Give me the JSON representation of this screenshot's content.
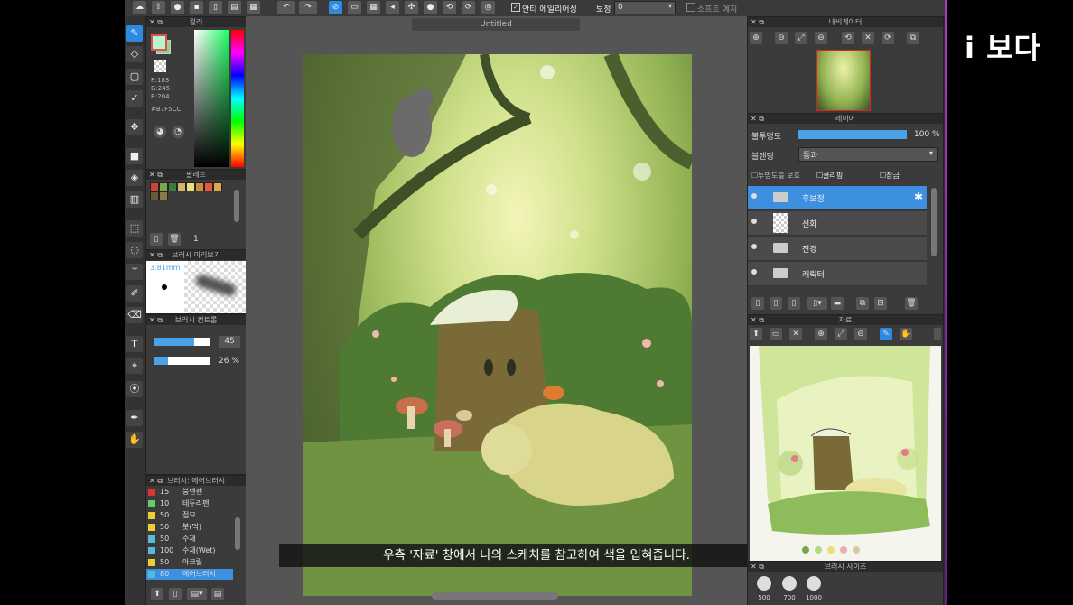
{
  "logo": "i 보다",
  "toolbar": {
    "title": "Untitled",
    "antialias_label": "안티 에일리어싱",
    "correction_label": "보정",
    "correction_value": "0",
    "soft_edge_label": "소프트 에지"
  },
  "color_panel": {
    "title": "컬러",
    "r": "R:183",
    "g": "G:245",
    "b": "B:204",
    "hex": "#B7F5CC",
    "fg_color": "#B7F5CC",
    "bg_color": "#8bd68a"
  },
  "palette_panel": {
    "title": "팔레트",
    "count": "1",
    "swatches": [
      "#c9453a",
      "#7aa64e",
      "#3f7a3d",
      "#d6b36a",
      "#e8e07a",
      "#c98c3a",
      "#e6563c",
      "#d9a84b",
      "#6b5a3a",
      "#8a7a4a"
    ]
  },
  "brush_preview": {
    "title": "브러시 미리보기",
    "size": "3.81mm"
  },
  "brush_control": {
    "title": "브러시 컨트롤",
    "size_value": "45",
    "opacity_value": "26 %",
    "size_fraction": 0.72,
    "opacity_fraction": 0.26
  },
  "brush_list": {
    "title": "브러시: 에어브러시",
    "items": [
      {
        "size": "15",
        "name": "붕텐펜",
        "color": "#d33"
      },
      {
        "size": "10",
        "name": "테두리펜",
        "color": "#6c6"
      },
      {
        "size": "50",
        "name": "점묘",
        "color": "#ec3"
      },
      {
        "size": "50",
        "name": "붓(먹)",
        "color": "#ec3"
      },
      {
        "size": "50",
        "name": "수채",
        "color": "#5bd"
      },
      {
        "size": "100",
        "name": "수채(Wet)",
        "color": "#5bd"
      },
      {
        "size": "50",
        "name": "아크릴",
        "color": "#ec3"
      },
      {
        "size": "80",
        "name": "에어브러시",
        "color": "#5bd"
      }
    ]
  },
  "navigator": {
    "title": "내비게이터"
  },
  "layer_panel": {
    "title": "레이어",
    "opacity_label": "불투명도",
    "opacity_value": "100 %",
    "opacity_fraction": 1.0,
    "blend_label": "블렌딩",
    "blend_value": "통과",
    "protect_alpha": "투명도를 보호",
    "clipping": "클리핑",
    "reference": "참금",
    "layers": [
      {
        "name": "후보정",
        "type": "folder",
        "selected": true
      },
      {
        "name": "선화",
        "type": "layer",
        "selected": false
      },
      {
        "name": "전경",
        "type": "folder",
        "selected": false
      },
      {
        "name": "캐릭터",
        "type": "folder",
        "selected": false
      }
    ]
  },
  "reference_panel": {
    "title": "자료"
  },
  "brush_size_panel": {
    "title": "브러시 사이즈",
    "sizes": [
      "500",
      "700",
      "1000"
    ]
  },
  "subtitle": "우측 '자료' 창에서 나의 스케치를 참고하여 색을 입혀줍니다."
}
